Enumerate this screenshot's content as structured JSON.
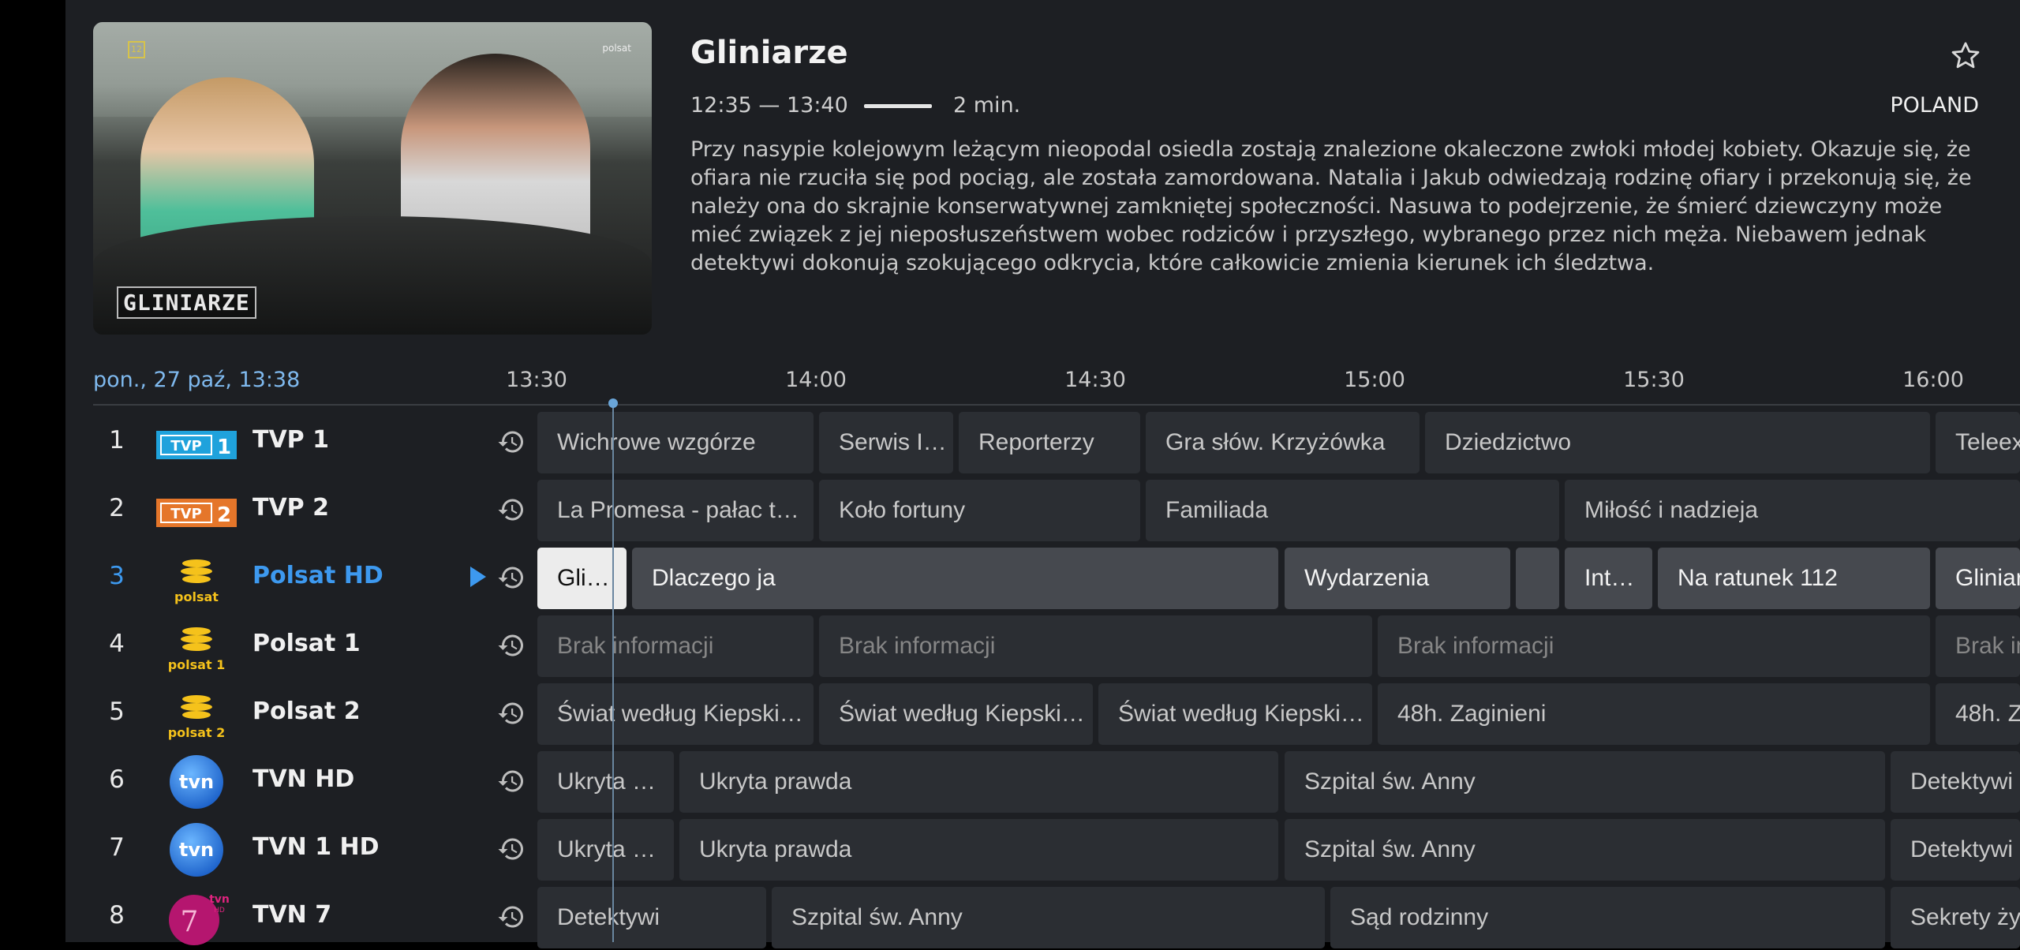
{
  "program": {
    "title": "Gliniarze",
    "time": "12:35 — 13:40",
    "remaining": "2 min.",
    "progress_pct": 97,
    "country": "POLAND",
    "description": "Przy nasypie kolejowym leżącym nieopodal osiedla zostają znalezione okaleczone zwłoki młodej kobiety. Okazuje się, że ofiara nie rzuciła się pod pociąg, ale została zamordowana. Natalia i Jakub odwiedzają rodzinę ofiary i przekonują się, że należy ona do skrajnie konserwatywnej zamkniętej społeczności. Nasuwa to podejrzenie, że śmierć dziewczyny może mieć związek z jej nieposłuszeństwem wobec rodziców i przyszłego, wybranego przez nich męża. Niebawem jednak detektywi dokonują szokującego odkrycia, które całkowicie zmienia kierunek ich śledztwa.",
    "thumb_logo": "GLINIARZE",
    "thumb_age": "12",
    "thumb_channel": "polsat"
  },
  "timeline": {
    "datetime": "pon., 27 paź, 13:38",
    "ticks": [
      "13:30",
      "14:00",
      "14:30",
      "15:00",
      "15:30",
      "16:00"
    ]
  },
  "channels": [
    {
      "num": "1",
      "name": "TVP 1",
      "logo": "TVP1",
      "programs": [
        "Wichrowe wzgórze",
        "Serwis I…",
        "Reporterzy",
        "Gra słów. Krzyżówka",
        "Dziedzictwo",
        "Teleex"
      ]
    },
    {
      "num": "2",
      "name": "TVP 2",
      "logo": "TVP2",
      "programs": [
        "La Promesa - pałac t…",
        "Koło fortuny",
        "Familiada",
        "Miłość i nadzieja"
      ]
    },
    {
      "num": "3",
      "name": "Polsat HD",
      "logo": "polsat",
      "active": true,
      "programs": [
        "Gli…",
        "Dlaczego ja",
        "Wydarzenia",
        "",
        "Int…",
        "Na ratunek 112",
        "Gliniar"
      ]
    },
    {
      "num": "4",
      "name": "Polsat 1",
      "logo": "polsat 1",
      "programs": [
        "Brak informacji",
        "Brak informacji",
        "Brak informacji",
        "Brak in"
      ]
    },
    {
      "num": "5",
      "name": "Polsat 2",
      "logo": "polsat 2",
      "programs": [
        "Świat według Kiepski…",
        "Świat według Kiepski…",
        "Świat według Kiepski…",
        "48h. Zaginieni",
        "48h. Z"
      ]
    },
    {
      "num": "6",
      "name": "TVN HD",
      "logo": "tvn",
      "programs": [
        "Ukryta …",
        "Ukryta prawda",
        "Szpital św. Anny",
        "Detektywi"
      ]
    },
    {
      "num": "7",
      "name": "TVN 1 HD",
      "logo": "tvn",
      "programs": [
        "Ukryta …",
        "Ukryta prawda",
        "Szpital św. Anny",
        "Detektywi"
      ]
    },
    {
      "num": "8",
      "name": "TVN 7",
      "logo": "7 tvn HD",
      "programs": [
        "Detektywi",
        "Szpital św. Anny",
        "Sąd rodzinny",
        "Sekrety życ"
      ]
    }
  ],
  "icons": {
    "favorite": "star-outline-icon",
    "history": "history-icon",
    "playing": "play-icon"
  }
}
